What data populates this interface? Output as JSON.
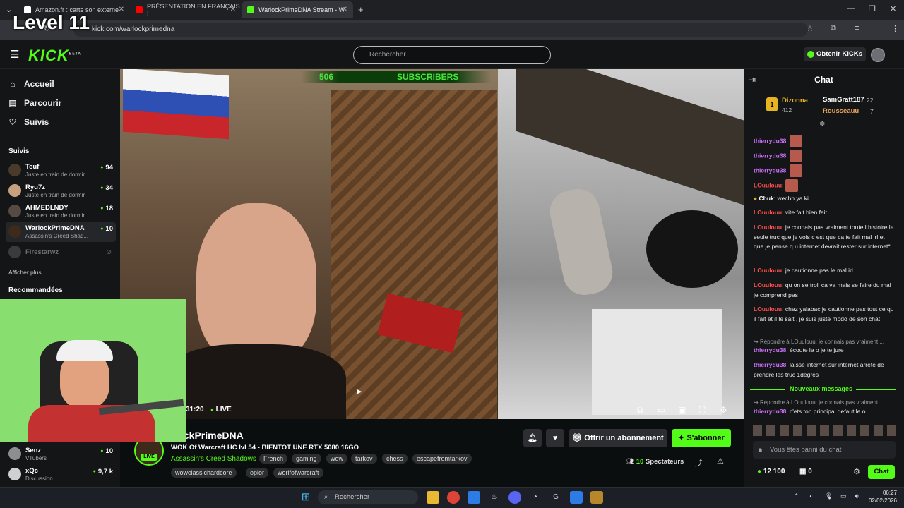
{
  "overlay": {
    "level_text": "Level 11"
  },
  "browser": {
    "tabs": [
      {
        "title": "Amazon.fr : carte son externe"
      },
      {
        "title": "PRÉSENTATION EN FRANÇAIS !"
      },
      {
        "title": "WarlockPrimeDNA Stream - W"
      }
    ],
    "url": "kick.com/warlockprimedna"
  },
  "header": {
    "logo": "KICK",
    "logo_badge": "BETA",
    "search_placeholder": "Rechercher",
    "kicks_button": "Obtenir KICKs"
  },
  "sidebar": {
    "nav": [
      {
        "label": "Accueil",
        "icon": "home-icon"
      },
      {
        "label": "Parcourir",
        "icon": "browse-icon"
      },
      {
        "label": "Suivis",
        "icon": "heart-icon"
      }
    ],
    "following_title": "Suivis",
    "following": [
      {
        "name": "Teuf",
        "sub": "Juste en train de dormir",
        "viewers": "94"
      },
      {
        "name": "Ryu7z",
        "sub": "Juste en train de dormir",
        "viewers": "34"
      },
      {
        "name": "AHMEDLNDY",
        "sub": "Juste en train de dormir",
        "viewers": "18"
      },
      {
        "name": "WarlockPrimeDNA",
        "sub": "Assassin's Creed Shad...",
        "viewers": "10"
      },
      {
        "name": "Firestarwz",
        "sub": "",
        "viewers": ""
      }
    ],
    "show_more": "Afficher plus",
    "recommended_title": "Recommandées",
    "recommended": [
      {
        "name": "Senz",
        "sub": "VTubers",
        "viewers": "10"
      },
      {
        "name": "xQc",
        "sub": "Discussion",
        "viewers": "9,7 k"
      }
    ]
  },
  "video": {
    "subs_count": "506",
    "subs_label": "SUBSCRIBERS",
    "time": "31:20",
    "live_label": "LIVE"
  },
  "stream": {
    "channel_name": "WarlockPrimeDNA",
    "channel_name_visible": "rlockPrimeDNA",
    "live_badge": "LIVE",
    "title": "WOK Of Warcraft HC lvl 54 - BIENTOT UNE RTX 5080 16GO",
    "category": "Assassin's Creed Shadows",
    "tags": [
      "French",
      "gaming",
      "wow",
      "tarkov",
      "chess",
      "escapefromtarkov",
      "wowclassichardcore",
      "opior",
      "worlfofwarcraft"
    ],
    "subscribe_gift": "Offrir un abonnement",
    "subscribe": "S'abonner",
    "viewers": "10",
    "viewers_label": "Spectateurs"
  },
  "chat": {
    "title": "Chat",
    "leaders": [
      {
        "name": "Dizonna",
        "value": "412"
      },
      {
        "name": "SamGratt187",
        "value": "22"
      },
      {
        "name": "Rousseauu",
        "value": "7"
      }
    ],
    "messages": [
      {
        "user": "thierrydu38",
        "text": "",
        "emote": true
      },
      {
        "user": "thierrydu38",
        "text": "",
        "emote": true
      },
      {
        "user": "thierrydu38",
        "text": "",
        "emote": true
      },
      {
        "user": "LOuulouu",
        "text": "",
        "emote": true
      },
      {
        "user": "Chuk",
        "text": "wechh ya ki"
      },
      {
        "user": "LOuulouu",
        "text": "vite fait bien fait"
      },
      {
        "user": "LOuulouu",
        "text": "je connais pas vraiment toute l histoire le seule truc que je vois c est que ca te fait mal irl et que je pense q u internet devrait rester sur internet*"
      },
      {
        "user": "LOuulouu",
        "text": "je cautionne pas le mal irl"
      },
      {
        "user": "LOuulouu",
        "text": "qu on se troll ca va mais se faire du mal je comprend pas"
      },
      {
        "user": "LOuulouu",
        "text": "chez yalabac je cautionne pas tout ce qu il fait et il le sait , je suis juste modo de son chat"
      },
      {
        "user": "thierrydu38",
        "text": "écoute le o je te jure",
        "reply": "Répondre à LOuulouu: je connais pas vraiment ..."
      },
      {
        "user": "thierrydu38",
        "text": "laisse internet sur internet arrete de prendre les truc 1degres"
      },
      {
        "user": "thierrydu38",
        "text": "c'ets ton principal defaut le o",
        "reply": "Répondre à LOuulouu: je connais pas vraiment ..."
      }
    ],
    "new_messages": "Nouveaux messages",
    "banned_text": "Vous êtes banni du chat",
    "points": "12 100",
    "drops": "0",
    "chat_button": "Chat"
  },
  "taskbar": {
    "search_placeholder": "Rechercher",
    "time": "06:27",
    "date": "02/02/2026"
  }
}
